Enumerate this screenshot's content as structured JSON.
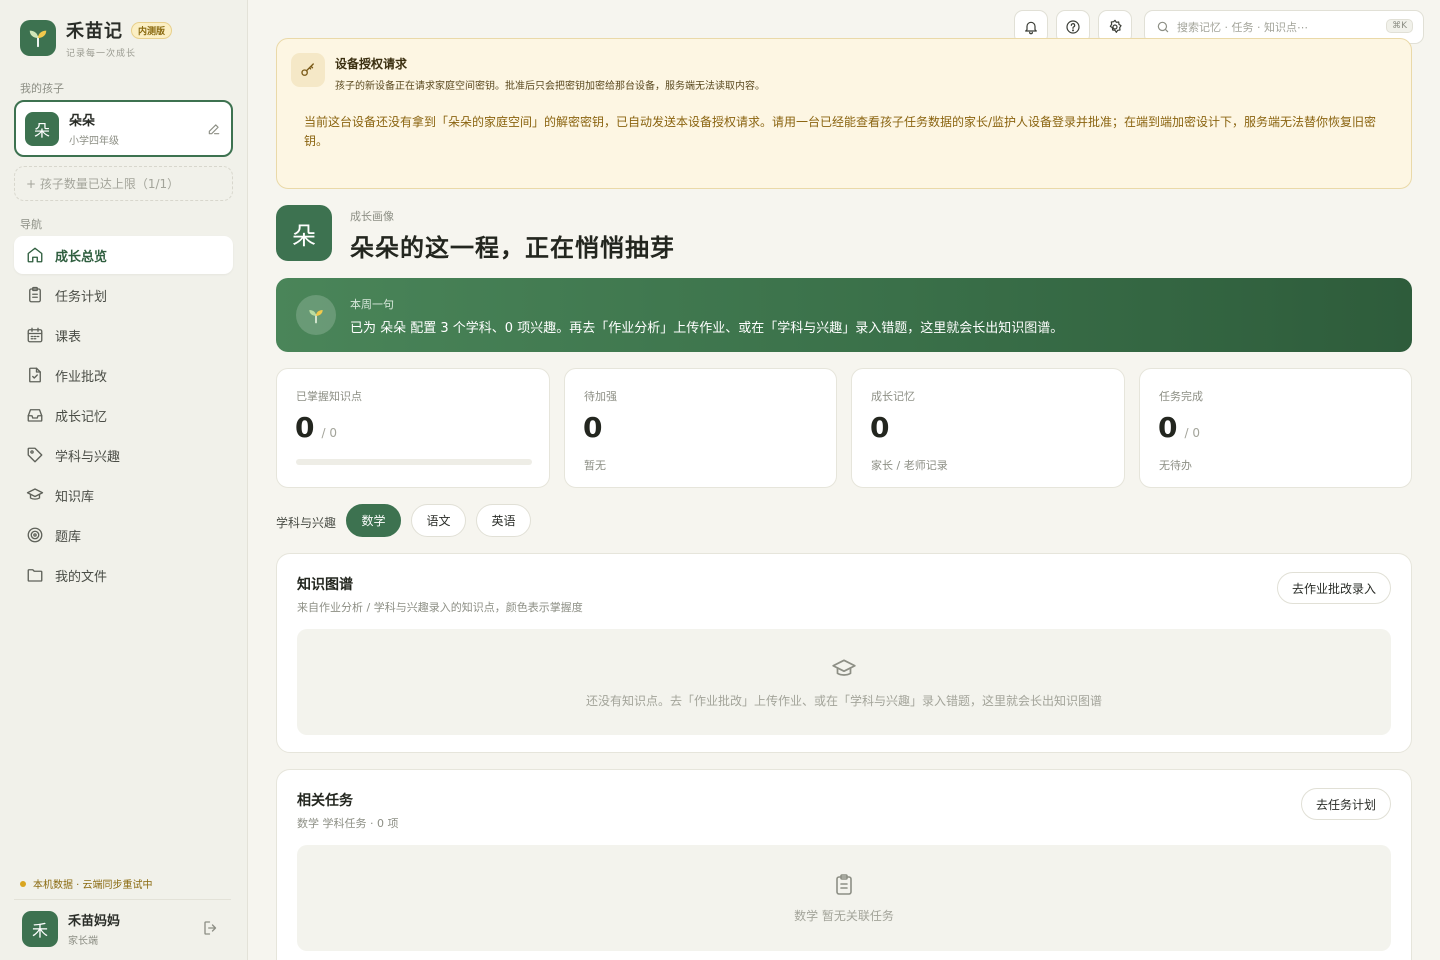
{
  "brand": {
    "name": "禾苗记",
    "badge": "内测版",
    "tagline": "记录每一次成长"
  },
  "sidebar": {
    "children_label": "我的孩子",
    "child": {
      "avatar": "朵",
      "name": "朵朵",
      "grade": "小学四年级"
    },
    "limit_text": "+ 孩子数量已达上限（1/1）",
    "nav_label": "导航",
    "nav": [
      {
        "label": "成长总览",
        "icon": "home-icon",
        "active": true
      },
      {
        "label": "任务计划",
        "icon": "clipboard-icon"
      },
      {
        "label": "课表",
        "icon": "calendar-icon"
      },
      {
        "label": "作业批改",
        "icon": "file-check-icon"
      },
      {
        "label": "成长记忆",
        "icon": "inbox-icon"
      },
      {
        "label": "学科与兴趣",
        "icon": "tag-icon"
      },
      {
        "label": "知识库",
        "icon": "graduation-cap-icon"
      },
      {
        "label": "题库",
        "icon": "target-icon"
      },
      {
        "label": "我的文件",
        "icon": "folder-icon"
      }
    ],
    "sync_status": "本机数据 · 云端同步重试中",
    "user": {
      "avatar": "禾",
      "name": "禾苗妈妈",
      "role": "家长端"
    }
  },
  "topbar": {
    "search_placeholder": "搜索记忆 · 任务 · 知识点⋯",
    "shortcut": "⌘K"
  },
  "auth_banner": {
    "title": "设备授权请求",
    "subtitle": "孩子的新设备正在请求家庭空间密钥。批准后只会把密钥加密给那台设备，服务端无法读取内容。",
    "body": "当前这台设备还没有拿到「朵朵的家庭空间」的解密密钥，已自动发送本设备授权请求。请用一台已经能查看孩子任务数据的家长/监护人设备登录并批准；在端到端加密设计下，服务端无法替你恢复旧密钥。"
  },
  "profile": {
    "avatar": "朵",
    "eyebrow": "成长画像",
    "title": "朵朵的这一程，正在悄悄抽芽"
  },
  "weekly": {
    "label": "本周一句",
    "text": "已为 朵朵 配置 3 个学科、0 项兴趣。再去「作业分析」上传作业、或在「学科与兴趣」录入错题，这里就会长出知识图谱。"
  },
  "stats": [
    {
      "label": "已掌握知识点",
      "value": "0",
      "total": "/ 0",
      "progress": 0
    },
    {
      "label": "待加强",
      "value": "0",
      "note": "暂无"
    },
    {
      "label": "成长记忆",
      "value": "0",
      "note": "家长 / 老师记录"
    },
    {
      "label": "任务完成",
      "value": "0",
      "total": "/ 0",
      "note": "无待办"
    }
  ],
  "subjects": {
    "label": "学科与兴趣",
    "tabs": [
      "数学",
      "语文",
      "英语"
    ],
    "active": "数学"
  },
  "knowledge_panel": {
    "title": "知识图谱",
    "subtitle": "来自作业分析 / 学科与兴趣录入的知识点，颜色表示掌握度",
    "button": "去作业批改录入",
    "empty": "还没有知识点。去「作业批改」上传作业、或在「学科与兴趣」录入错题，这里就会长出知识图谱"
  },
  "tasks_panel": {
    "title": "相关任务",
    "subtitle": "数学 学科任务 · 0 项",
    "button": "去任务计划",
    "empty": "数学 暂无关联任务"
  },
  "colors": {
    "brand_green": "#3d7250",
    "warning_bg": "#fdf6e3",
    "warning_text": "#8a6410",
    "page_bg": "#f6f5ef"
  }
}
